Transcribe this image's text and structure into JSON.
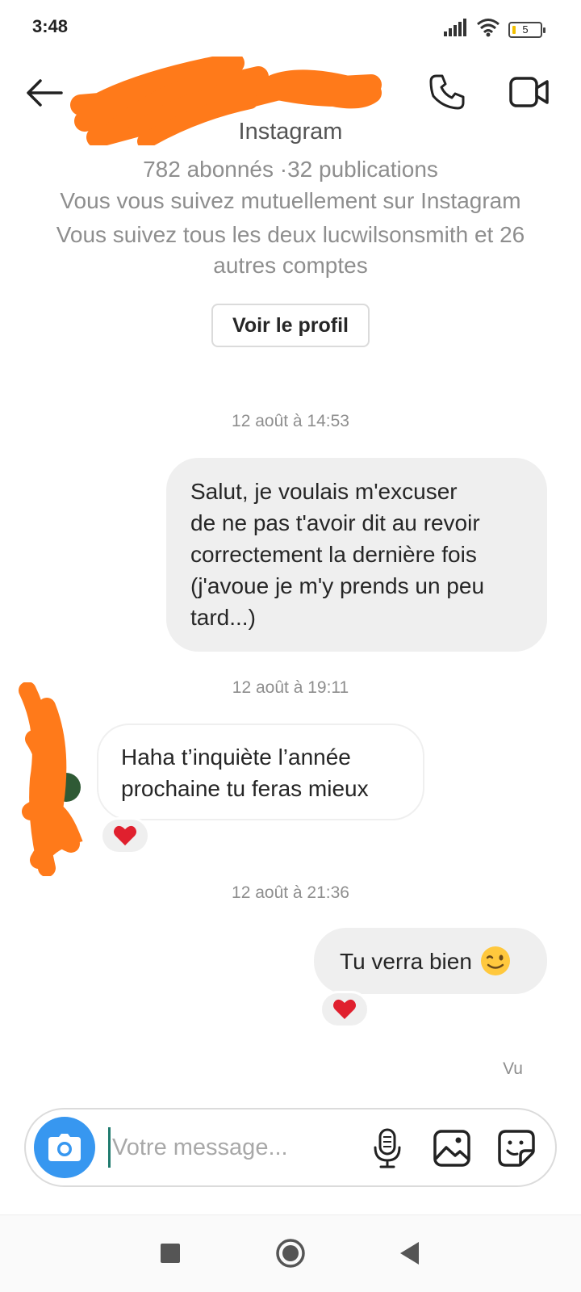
{
  "status_bar": {
    "time": "3:48",
    "battery": "5",
    "icons": [
      "signal-icon",
      "wifi-icon",
      "battery-icon"
    ]
  },
  "header": {
    "icons": [
      "back-arrow-icon",
      "phone-icon",
      "video-camera-icon"
    ]
  },
  "profile": {
    "platform": "Instagram",
    "stats": "782 abonnés ·32 publications",
    "mutual": "Vous vous suivez mutuellement sur Instagram",
    "common": "Vous suivez tous les deux lucwilsonsmith et 26 autres comptes",
    "view_profile_label": "Voir le profil"
  },
  "messages": [
    {
      "timestamp": "12 août à 14:53",
      "direction": "sent",
      "lines": [
        "Salut, je voulais m'excuser",
        "de ne pas t'avoir dit au revoir",
        "correctement la dernière fois",
        "(j'avoue je m'y prends un peu",
        "tard...)"
      ],
      "reaction": null
    },
    {
      "timestamp": "12 août à 19:11",
      "direction": "received",
      "lines": [
        "Haha t’inquiète l’année",
        "prochaine tu feras mieux"
      ],
      "reaction": "heart"
    },
    {
      "timestamp": "12 août à 21:36",
      "direction": "sent",
      "lines": [
        "Tu verra bien"
      ],
      "emoji": "winking-face",
      "reaction": "heart"
    }
  ],
  "seen_label": "Vu",
  "composer": {
    "placeholder": "Votre message...",
    "icons": [
      "camera-icon",
      "microphone-icon",
      "gallery-icon",
      "sticker-icon"
    ]
  },
  "colors": {
    "accent_blue": "#3797f0",
    "sent_bubble": "#efefef",
    "reaction_heart": "#e0202e",
    "redaction_orange": "#ff7a1a",
    "secondary_text": "#8e8e8e"
  }
}
